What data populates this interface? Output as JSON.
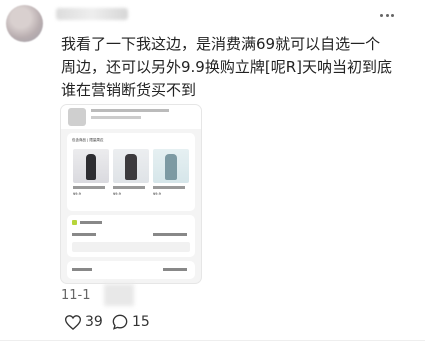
{
  "post": {
    "lines": [
      "我看了一下我这边，是消费满69就可以自选一个",
      "周边，还可以另外9.9换购立牌[呢R]天呐当初到底",
      "谁在营销断货买不到"
    ],
    "date": "11-1",
    "likes": "39",
    "comments": "15"
  },
  "screenshot": {
    "section_title": "包含商品 | 限量周边",
    "products": [
      {
        "price": "¥9.9",
        "color": "#e8e8ea"
      },
      {
        "price": "¥9.9",
        "color": "#e6eaee"
      },
      {
        "price": "¥9.9",
        "color": "#e3eef0"
      }
    ]
  },
  "icons": {
    "more": "more-icon",
    "like": "heart-icon",
    "comment": "comment-icon"
  }
}
